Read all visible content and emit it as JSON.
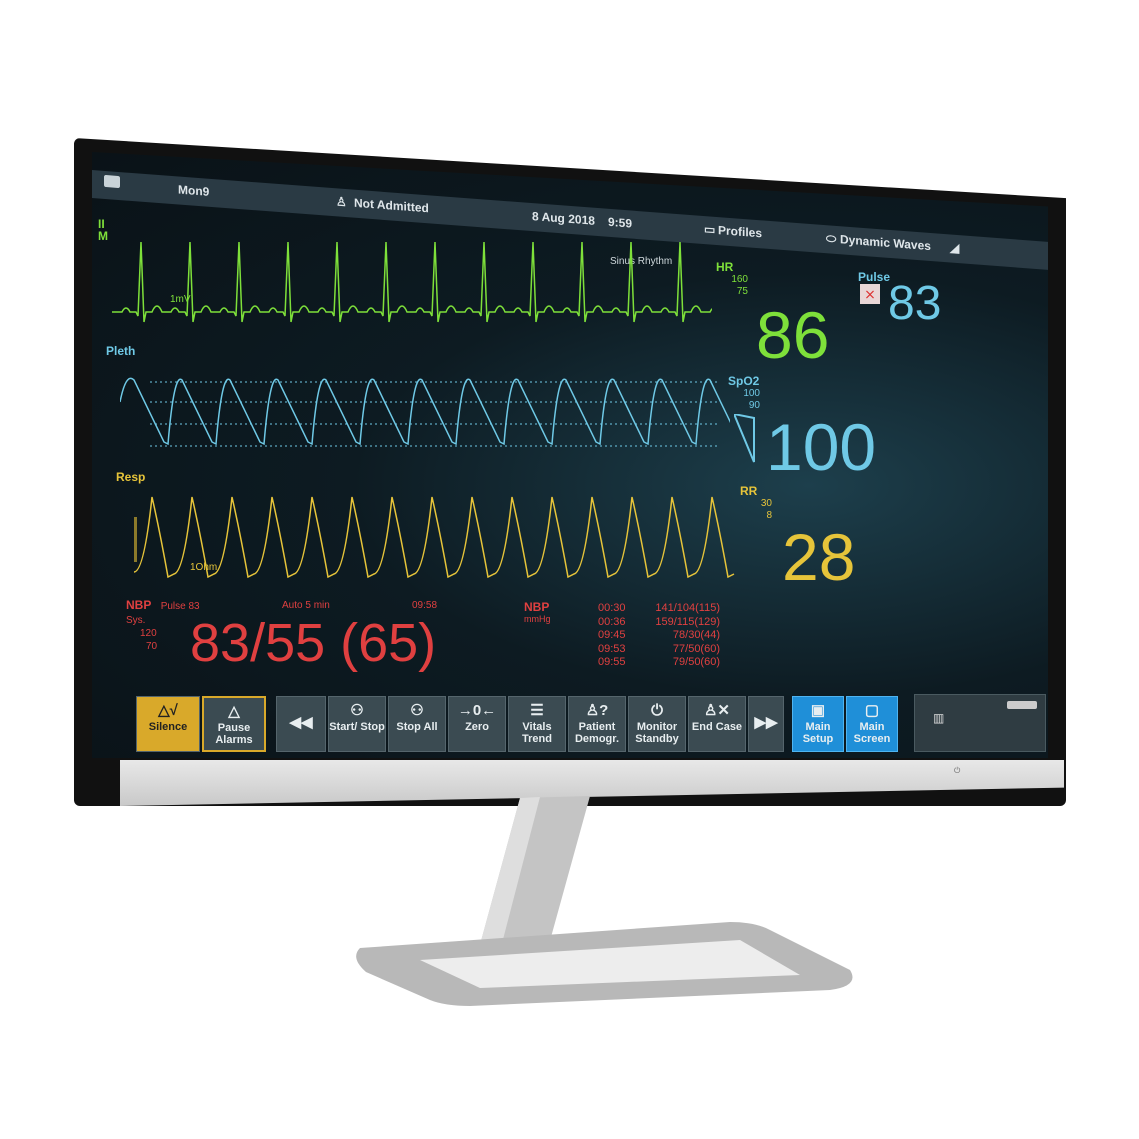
{
  "header": {
    "monitor_name": "Mon9",
    "patient_status": "Not Admitted",
    "date": "8 Aug 2018",
    "time": "9:59",
    "profiles": "Profiles",
    "dynamic_waves": "Dynamic Waves"
  },
  "ecg": {
    "lead": "II",
    "mode": "M",
    "scale": "1mV",
    "rhythm": "Sinus Rhythm",
    "hr_label": "HR",
    "hr_high": "160",
    "hr_low": "75",
    "hr_value": "86",
    "color": "#7ee03a"
  },
  "pulse": {
    "label": "Pulse",
    "value": "83",
    "color": "#6fc9e6"
  },
  "pleth": {
    "label": "Pleth",
    "spo2_label": "SpO2",
    "spo2_high": "100",
    "spo2_low": "90",
    "spo2_value": "100",
    "color": "#6fc9e6"
  },
  "resp": {
    "label": "Resp",
    "scale": "1Ohm",
    "rr_label": "RR",
    "rr_high": "30",
    "rr_low": "8",
    "rr_value": "28",
    "color": "#e6c43a"
  },
  "nbp": {
    "label": "NBP",
    "pulse": "Pulse 83",
    "mode": "Auto  5 min",
    "time": "09:58",
    "sys_label": "Sys.",
    "sys_high": "120",
    "sys_low": "70",
    "value": "83/55 (65)",
    "color": "#e04040",
    "history_label": "NBP",
    "history_unit": "mmHg",
    "history": [
      {
        "time": "00:30",
        "value": "141/104(115)"
      },
      {
        "time": "00:36",
        "value": "159/115(129)"
      },
      {
        "time": "09:45",
        "value": "78/30(44)"
      },
      {
        "time": "09:53",
        "value": "77/50(60)"
      },
      {
        "time": "09:55",
        "value": "79/50(60)"
      }
    ]
  },
  "buttons": [
    {
      "label": "Silence",
      "icon": "silence-icon",
      "glyph": "△√"
    },
    {
      "label": "Pause Alarms",
      "icon": "pause-alarms-icon",
      "glyph": "△"
    },
    {
      "label": "",
      "icon": "rewind-icon",
      "glyph": "◀◀"
    },
    {
      "label": "Start/ Stop",
      "icon": "start-stop-icon",
      "glyph": "⚇"
    },
    {
      "label": "Stop All",
      "icon": "stop-all-icon",
      "glyph": "⚇"
    },
    {
      "label": "Zero",
      "icon": "zero-icon",
      "glyph": "→0←"
    },
    {
      "label": "Vitals Trend",
      "icon": "vitals-trend-icon",
      "glyph": "☰"
    },
    {
      "label": "Patient Demogr.",
      "icon": "patient-demographics-icon",
      "glyph": "♙?"
    },
    {
      "label": "Monitor Standby",
      "icon": "power-icon",
      "glyph": "⏻"
    },
    {
      "label": "End Case",
      "icon": "end-case-icon",
      "glyph": "♙✕"
    },
    {
      "label": "",
      "icon": "fast-forward-icon",
      "glyph": "▶▶"
    },
    {
      "label": "Main Setup",
      "icon": "main-setup-icon",
      "glyph": "▣"
    },
    {
      "label": "Main Screen",
      "icon": "main-screen-icon",
      "glyph": "▢"
    }
  ]
}
